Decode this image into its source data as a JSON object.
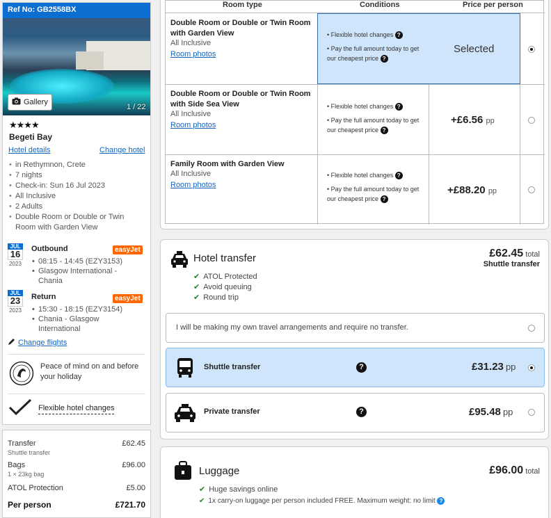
{
  "hotel": {
    "ref": "Ref No: GB2558BX",
    "gallery_label": "Gallery",
    "image_count": "1 / 22",
    "stars": "★★★★",
    "name": "Begeti Bay",
    "details_link": "Hotel details",
    "change_link": "Change hotel",
    "facts": [
      "in Rethymnon, Crete",
      "7 nights",
      "Check-in: Sun 16 Jul 2023",
      "All Inclusive",
      "2 Adults",
      "Double Room or Double or Twin Room with Garden View"
    ]
  },
  "flights": {
    "outbound": {
      "month": "JUL",
      "day": "16",
      "year": "2023",
      "title": "Outbound",
      "airline": "easyJet",
      "time": "08:15 - 14:45 (EZY3153)",
      "route": "Glasgow International - Chania"
    },
    "return": {
      "month": "JUL",
      "day": "23",
      "year": "2023",
      "title": "Return",
      "airline": "easyJet",
      "time": "15:30 - 18:15 (EZY3154)",
      "route": "Chania - Glasgow International"
    },
    "change_link": "Change flights"
  },
  "protection": {
    "text": "Peace of mind on and before your holiday",
    "badge": "ATOL PROTECTED"
  },
  "flexible": {
    "label": "Flexible hotel changes"
  },
  "price_summary": {
    "transfer_label": "Transfer",
    "transfer_value": "£62.45",
    "transfer_sub": "Shuttle transfer",
    "bags_label": "Bags",
    "bags_value": "£96.00",
    "bags_sub": "1 × 23kg bag",
    "atol_label": "ATOL Protection",
    "atol_value": "£5.00",
    "pp_label": "Per person",
    "pp_value": "£721.70"
  },
  "rooms": {
    "headers": {
      "type": "Room type",
      "conditions": "Conditions",
      "price": "Price per person"
    },
    "items": [
      {
        "name": "Double Room or Double or Twin Room with Garden View",
        "board": "All Inclusive",
        "photos": "Room photos",
        "cond1": "Flexible hotel changes",
        "cond2": "Pay the full amount today to get our cheapest price",
        "price": "Selected",
        "pp": ""
      },
      {
        "name": "Double Room or Double or Twin Room with Side Sea View",
        "board": "All Inclusive",
        "photos": "Room photos",
        "cond1": "Flexible hotel changes",
        "cond2": "Pay the full amount today to get our cheapest price",
        "price": "+£6.56",
        "pp": "pp"
      },
      {
        "name": "Family Room with Garden View",
        "board": "All Inclusive",
        "photos": "Room photos",
        "cond1": "Flexible hotel changes",
        "cond2": "Pay the full amount today to get our cheapest price",
        "price": "+£88.20",
        "pp": "pp"
      }
    ]
  },
  "transfer": {
    "title": "Hotel transfer",
    "total": "£62.45",
    "total_suffix": "total",
    "total_sub": "Shuttle transfer",
    "features": [
      "ATOL Protected",
      "Avoid queuing",
      "Round trip"
    ],
    "own_text": "I will be making my own travel arrangements and require no transfer.",
    "shuttle_label": "Shuttle transfer",
    "shuttle_price": "£31.23",
    "shuttle_pp": "pp",
    "private_label": "Private transfer",
    "private_price": "£95.48",
    "private_pp": "pp"
  },
  "luggage": {
    "title": "Luggage",
    "total": "£96.00",
    "total_suffix": "total",
    "feature1": "Huge savings online",
    "feature2": "1x carry-on luggage per person included FREE. Maximum weight: no limit"
  },
  "colors": {
    "accent": "#0d6ed1",
    "selected_bg": "#cfe5fb",
    "easyjet": "#ff6600",
    "check": "#2e7d32"
  }
}
